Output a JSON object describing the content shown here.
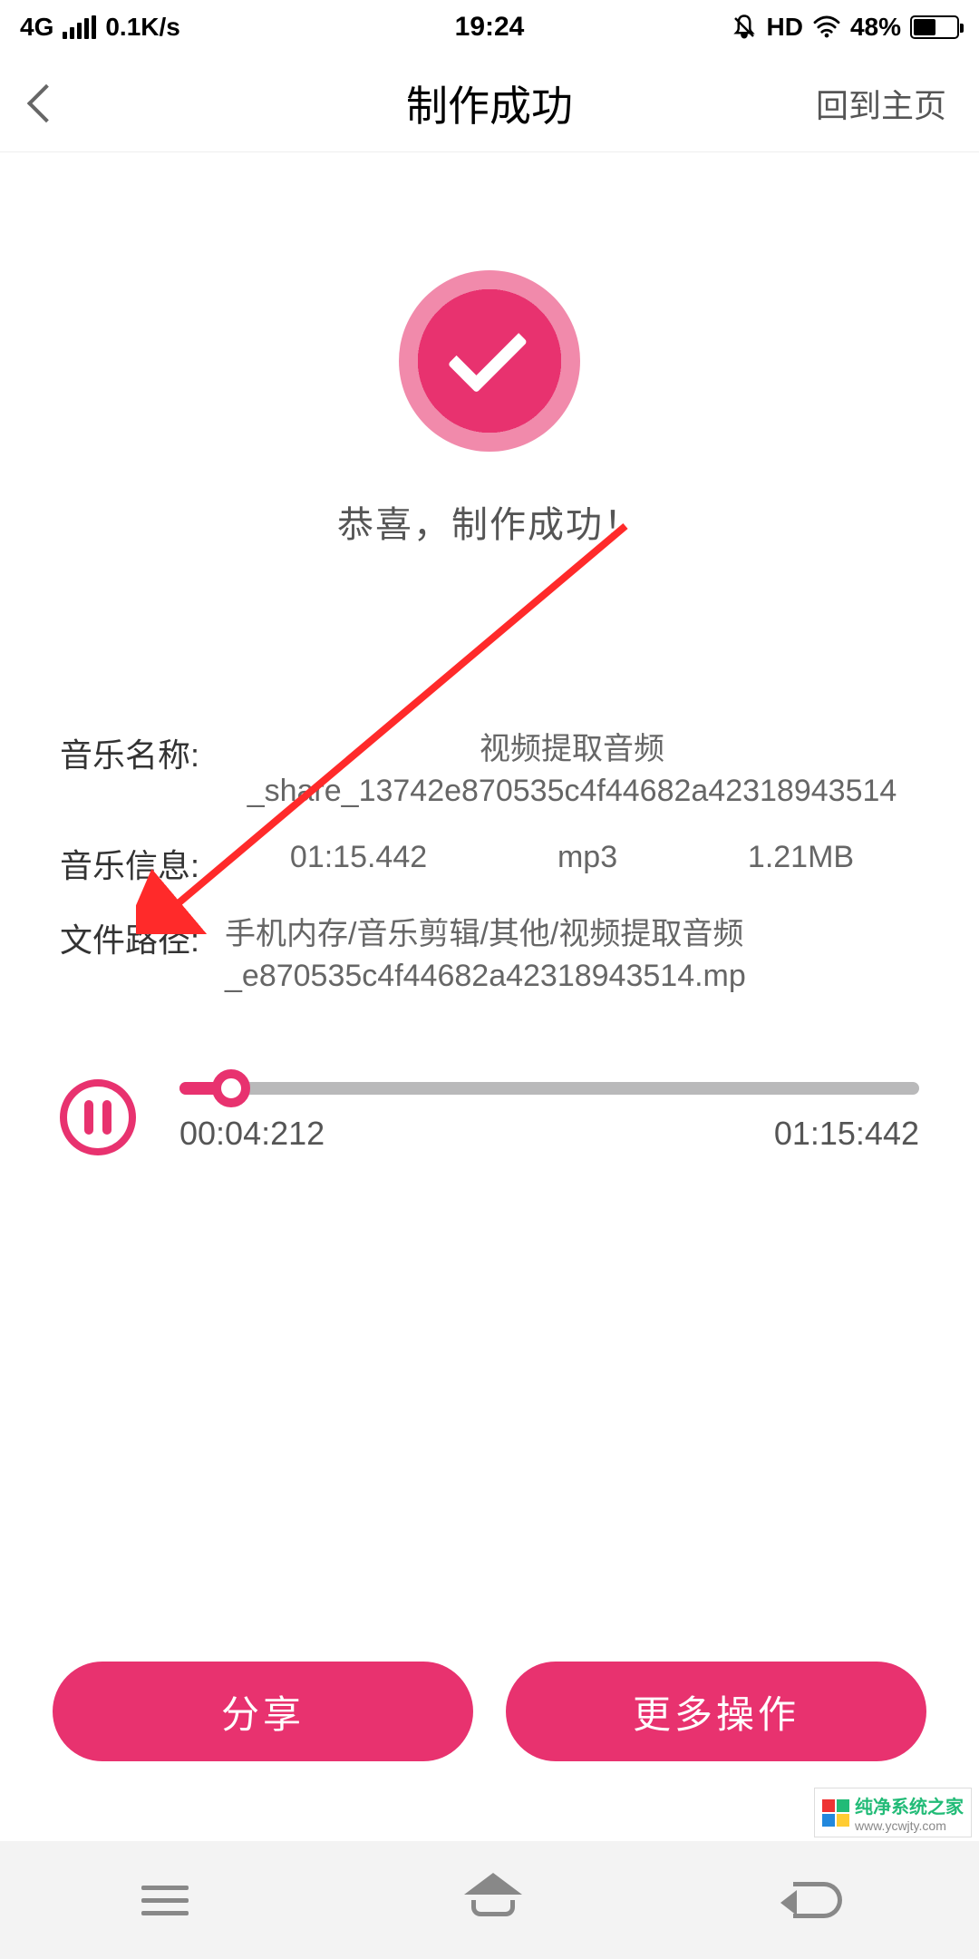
{
  "status": {
    "network_type": "4G",
    "speed": "0.1K/s",
    "time": "19:24",
    "hd_label": "HD",
    "battery_pct": "48%"
  },
  "header": {
    "title": "制作成功",
    "home_link": "回到主页"
  },
  "success": {
    "message": "恭喜，制作成功！"
  },
  "info": {
    "name_label": "音乐名称:",
    "name_value": "视频提取音频_share_13742e870535c4f44682a42318943514",
    "meta_label": "音乐信息:",
    "duration": "01:15.442",
    "format": "mp3",
    "size": "1.21MB",
    "path_label": "文件路径:",
    "path_value": "手机内存/音乐剪辑/其他/视频提取音频_e870535c4f44682a42318943514.mp"
  },
  "player": {
    "current": "00:04:212",
    "total": "01:15:442",
    "progress_pct": 7
  },
  "actions": {
    "share": "分享",
    "more": "更多操作"
  },
  "watermark": {
    "line1": "纯净系统之家",
    "line2": "www.ycwjty.com"
  },
  "colors": {
    "accent": "#e8326f"
  }
}
